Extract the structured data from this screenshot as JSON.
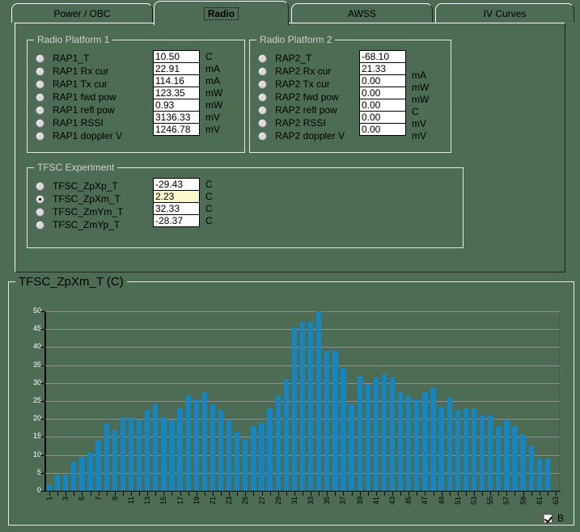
{
  "tabs": [
    {
      "label": "Power / OBC",
      "selected": false
    },
    {
      "label": "Radio",
      "selected": true
    },
    {
      "label": "AWSS",
      "selected": false
    },
    {
      "label": "IV Curves",
      "selected": false
    }
  ],
  "groups": {
    "radio_platform_1": {
      "title": "Radio Platform 1",
      "rows": [
        {
          "label": "RAP1_T",
          "value": "10.50",
          "unit": "C",
          "selected": false
        },
        {
          "label": "RAP1 Rx cur",
          "value": "22.91",
          "unit": "mA",
          "selected": false
        },
        {
          "label": "RAP1 Tx cur",
          "value": "114.16",
          "unit": "mA",
          "selected": false
        },
        {
          "label": "RAP1 fwd pow",
          "value": "123.35",
          "unit": "mW",
          "selected": false
        },
        {
          "label": "RAP1 refl pow",
          "value": "0.93",
          "unit": "mW",
          "selected": false
        },
        {
          "label": "RAP1 RSSI",
          "value": "3136.33",
          "unit": "mV",
          "selected": false
        },
        {
          "label": "RAP1 doppler V",
          "value": "1246.78",
          "unit": "mV",
          "selected": false
        }
      ]
    },
    "radio_platform_2": {
      "title": "Radio Platform 2",
      "rows": [
        {
          "label": "RAP2_T",
          "value": "-68.10",
          "unit": "",
          "selected": false
        },
        {
          "label": "RAP2 Rx cur",
          "value": "21.33",
          "unit": "mA",
          "selected": false
        },
        {
          "label": "RAP2 Tx cur",
          "value": "0.00",
          "unit": "mW",
          "selected": false
        },
        {
          "label": "RAP2 fwd pow",
          "value": "0.00",
          "unit": "mW",
          "selected": false
        },
        {
          "label": "RAP2 refl pow",
          "value": "0.00",
          "unit": "C",
          "selected": false
        },
        {
          "label": "RAP2 RSSI",
          "value": "0.00",
          "unit": "mV",
          "selected": false
        },
        {
          "label": "RAP2 doppler V",
          "value": "0.00",
          "unit": "mV",
          "selected": false
        }
      ]
    },
    "tfsc_experiment": {
      "title": "TFSC Experiment",
      "rows": [
        {
          "label": "TFSC_ZpXp_T",
          "value": "-29.43",
          "unit": "C",
          "selected": false,
          "highlight": false
        },
        {
          "label": "TFSC_ZpXm_T",
          "value": "2.23",
          "unit": "C",
          "selected": true,
          "highlight": true
        },
        {
          "label": "TFSC_ZmYm_T",
          "value": "32.33",
          "unit": "C",
          "selected": false,
          "highlight": false
        },
        {
          "label": "TFSC_ZmYp_T",
          "value": "-28.37",
          "unit": "C",
          "selected": false,
          "highlight": false
        }
      ]
    }
  },
  "chart_checkbox": {
    "label": "B",
    "checked": true
  },
  "chart_data": {
    "type": "bar",
    "title": "TFSC_ZpXm_T (C)",
    "xlabel": "",
    "ylabel": "",
    "ylim": [
      0,
      50
    ],
    "yticks": [
      0,
      5,
      10,
      15,
      20,
      25,
      30,
      35,
      40,
      45,
      50
    ],
    "grid": true,
    "legend": false,
    "bar_color": "#1287c8",
    "plot_background": "#4c6c54",
    "categories": [
      1,
      2,
      3,
      4,
      5,
      6,
      7,
      8,
      9,
      10,
      11,
      12,
      13,
      14,
      15,
      16,
      17,
      18,
      19,
      20,
      21,
      22,
      23,
      24,
      25,
      26,
      27,
      28,
      29,
      30,
      31,
      32,
      33,
      34,
      35,
      36,
      37,
      38,
      39,
      40,
      41,
      42,
      43,
      44,
      45,
      46,
      47,
      48,
      49,
      50,
      51,
      52,
      53,
      54,
      55,
      56,
      57,
      58,
      59,
      60,
      61,
      62,
      63
    ],
    "xtick_labels": [
      1,
      3,
      5,
      7,
      9,
      11,
      13,
      15,
      17,
      19,
      21,
      23,
      25,
      27,
      29,
      31,
      33,
      35,
      37,
      39,
      41,
      43,
      45,
      47,
      49,
      51,
      53,
      55,
      57,
      59,
      61,
      63
    ],
    "values": [
      1.5,
      4.5,
      4.5,
      8.0,
      9.5,
      10.5,
      14.0,
      19.0,
      17.0,
      20.5,
      20.5,
      19.5,
      22.5,
      24.0,
      20.5,
      19.5,
      23.0,
      26.5,
      25.5,
      27.5,
      24.0,
      22.5,
      19.5,
      16.5,
      14.5,
      18.0,
      19.0,
      23.0,
      26.5,
      31.0,
      45.5,
      47.0,
      47.0,
      50.0,
      39.0,
      39.0,
      34.0,
      24.0,
      32.0,
      29.5,
      31.5,
      32.5,
      31.5,
      27.5,
      26.5,
      25.5,
      27.5,
      28.5,
      23.5,
      26.0,
      22.5,
      23.0,
      23.0,
      21.0,
      21.0,
      18.0,
      19.5,
      18.0,
      15.5,
      12.5,
      9.0,
      9.0,
      0.0
    ]
  }
}
